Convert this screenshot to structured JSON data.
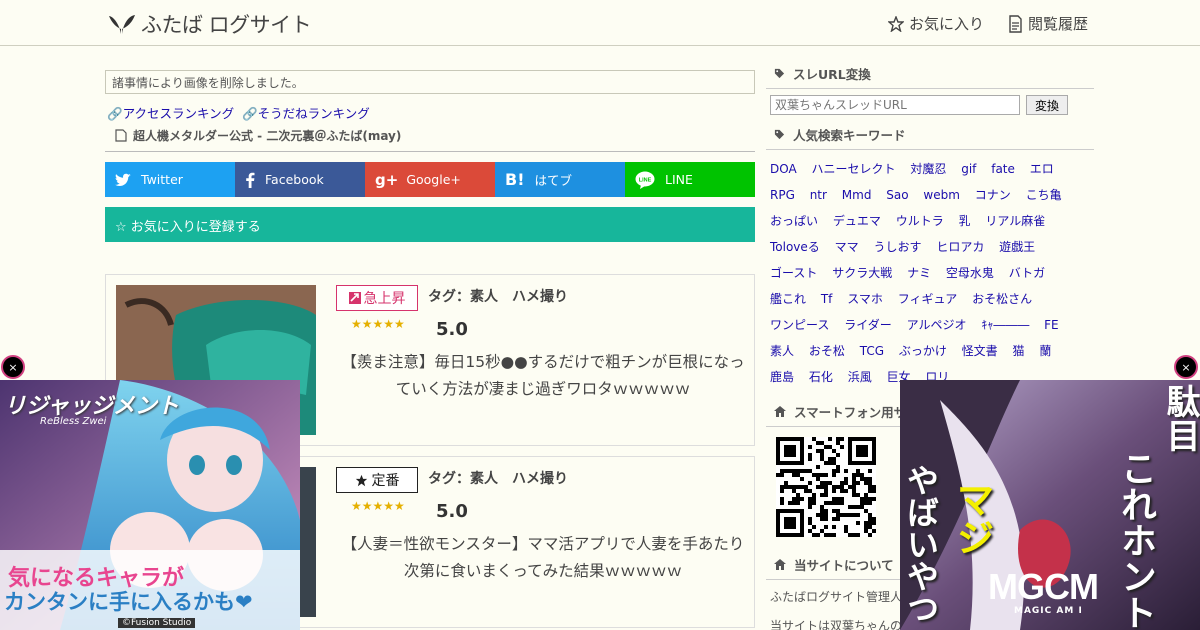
{
  "header": {
    "site_name": "ふたば ログサイト",
    "favorites_label": "お気に入り",
    "history_label": "閲覧履歴"
  },
  "main": {
    "notice": "諸事情により画像を削除しました。",
    "links": [
      "アクセスランキング",
      "そうだねランキング"
    ],
    "source": "超人機メタルダー公式 - 二次元裏＠ふたば(may)",
    "share_buttons": [
      {
        "label": "Twitter",
        "color": "#1da1f2"
      },
      {
        "label": "Facebook",
        "color": "#3b5998"
      },
      {
        "label": "Google+",
        "color": "#db4a39"
      },
      {
        "label": "はてブ",
        "color": "#1e90e0"
      },
      {
        "label": "LINE",
        "color": "#00c300"
      }
    ],
    "favorite_button": "☆ お気に入りに登録する",
    "articles": [
      {
        "badge": "急上昇",
        "badge_color": "#d6336c",
        "tag": "タグ：素人　ハメ撮り",
        "stars": "★★★★★",
        "score": "5.0",
        "title": "【羨ま注意】毎日15秒●●するだけで粗チンが巨根になっていく方法が凄まじ過ぎワロタｗｗｗｗｗ"
      },
      {
        "badge": "定番",
        "badge_color": "#222222",
        "tag": "タグ：素人　ハメ撮り",
        "stars": "★★★★★",
        "score": "5.0",
        "title": "【人妻＝性欲モンスター】ママ活アプリで人妻を手あたり次第に食いまくってみた結果ｗｗｗｗｗ"
      }
    ]
  },
  "sidebar": {
    "url_convert_heading": "スレURL変換",
    "url_placeholder": "双葉ちゃんスレッドURL",
    "convert_button": "変換",
    "keywords_heading": "人気検索キーワード",
    "keywords": [
      "DOA",
      "ハニーセレクト",
      "対魔忍",
      "gif",
      "fate",
      "エロ",
      "RPG",
      "ntr",
      "Mmd",
      "Sao",
      "webm",
      "コナン",
      "こち亀",
      "おっぱい",
      "デュエマ",
      "ウルトラ",
      "乳",
      "リアル麻雀",
      "Toloveる",
      "ママ",
      "うしおす",
      "ヒロアカ",
      "遊戯王",
      "ゴースト",
      "サクラ大戦",
      "ナミ",
      "空母水鬼",
      "バトガ",
      "艦これ",
      "Tf",
      "スマホ",
      "フィギュア",
      "おそ松さん",
      "ワンピース",
      "ライダー",
      "アルペジオ",
      "ｷｬ―――",
      "FE",
      "素人",
      "おそ松",
      "TCG",
      "ぶっかけ",
      "怪文書",
      "猫",
      "蘭",
      "鹿島",
      "石化",
      "浜風",
      "巨女",
      "ロリ"
    ],
    "smartphone_heading": "スマートフォン用サイト",
    "about_heading": "当サイトについて",
    "about_text_1": "ふたばログサイト管理人",
    "about_text_2": "当サイトは双葉ちゃんの"
  },
  "ads": {
    "left_title": "リジャッジメント",
    "left_subtitle": "ReBless Zwei",
    "left_tagline_1": "気になるキャラが",
    "left_tagline_2": "カンタンに手に入るかも❤",
    "left_credit": "©Fusion Studio",
    "right_text_1": "駄目",
    "right_text_2": "これホント",
    "right_text_3": "マジ",
    "right_text_4": "やばいやつ",
    "right_logo": "MGCM",
    "right_logo_sub": "MAGIC AM I",
    "close_label": "×"
  }
}
